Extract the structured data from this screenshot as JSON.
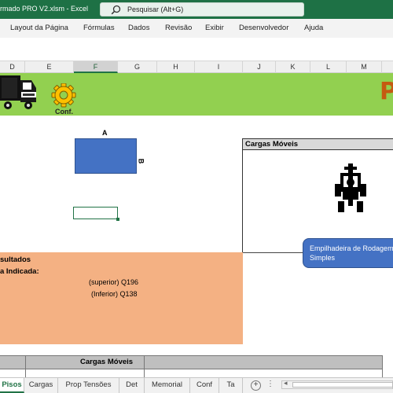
{
  "window": {
    "title": "rmado PRO V2.xlsm  -  Excel",
    "search_placeholder": "Pesquisar (Alt+G)"
  },
  "menu": [
    {
      "label": "Layout da Página"
    },
    {
      "label": "Fórmulas"
    },
    {
      "label": "Dados"
    },
    {
      "label": "Revisão"
    },
    {
      "label": "Exibir"
    },
    {
      "label": "Desenvolvedor"
    },
    {
      "label": "Ajuda"
    }
  ],
  "columns": [
    "D",
    "E",
    "F",
    "G",
    "H",
    "I",
    "J",
    "K",
    "L",
    "M"
  ],
  "selected_column": "F",
  "sheet": {
    "conf_label": "Conf.",
    "logo_letter": "P",
    "rect_width_label": "A",
    "rect_height_label": "B",
    "cargas_moveis_header": "Cargas Móveis",
    "forklift_button": "Empilhadeira de Rodagem Simples",
    "results_title": "sultados",
    "results_subtitle": "a Indicada:",
    "line_superior": "(superior) Q196",
    "line_inferior": "(Inferior) Q138",
    "bottom_header": "Cargas Móveis"
  },
  "colors": {
    "excel_green": "#1e7145",
    "banner_green": "#92d050",
    "shape_blue": "#4472c4",
    "results_orange": "#f4b183"
  },
  "tabs": [
    {
      "label": "Pisos",
      "active": true
    },
    {
      "label": "Cargas",
      "active": false
    },
    {
      "label": "Prop Tensões",
      "active": false
    },
    {
      "label": "Det",
      "active": false
    },
    {
      "label": "Memorial",
      "active": false
    },
    {
      "label": "Conf",
      "active": false
    },
    {
      "label": "Ta",
      "active": false
    }
  ],
  "tab_controls": {
    "add": "+",
    "more": "⋮"
  }
}
